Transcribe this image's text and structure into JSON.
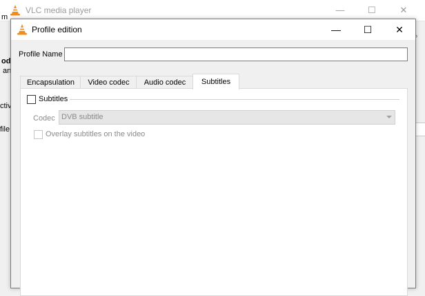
{
  "background_window": {
    "title": "VLC media player",
    "controls": [
      "—",
      "☐",
      "✕"
    ],
    "fragments": [
      "m",
      "#",
      "odir",
      "an",
      "ctiva",
      "file",
      "?"
    ]
  },
  "dialog": {
    "title": "Profile edition",
    "controls": {
      "minimize": "—",
      "maximize": "☐",
      "close": "✕"
    },
    "profile_name": {
      "label": "Profile Name",
      "value": ""
    },
    "tabs": [
      {
        "label": "Encapsulation",
        "active": false
      },
      {
        "label": "Video codec",
        "active": false
      },
      {
        "label": "Audio codec",
        "active": false
      },
      {
        "label": "Subtitles",
        "active": true
      }
    ],
    "subtitles": {
      "enable_label": "Subtitles",
      "enabled": false,
      "codec_label": "Codec",
      "codec_value": "DVB subtitle",
      "overlay_label": "Overlay subtitles on the video",
      "overlay_checked": false
    }
  },
  "colors": {
    "vlc_orange": "#f28c1b",
    "cone_white": "#ffffff"
  }
}
